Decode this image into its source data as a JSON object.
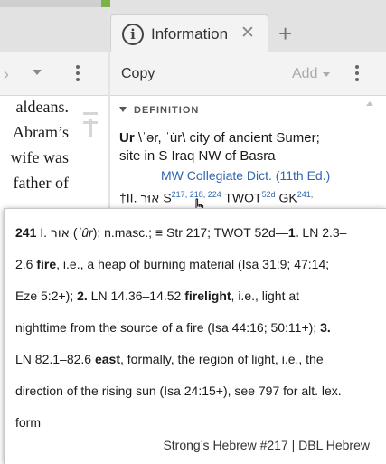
{
  "left_pane": {
    "reading_lines": [
      "aldeans.",
      "Abram’s",
      "wife was",
      "father of"
    ]
  },
  "right_pane": {
    "tab": {
      "icon": "info-circle-icon",
      "label": "Information"
    },
    "toolbar": {
      "copy_label": "Copy",
      "add_label": "Add"
    },
    "section_title": "DEFINITION",
    "definition": {
      "headword": "Ur",
      "pronunciation": "\\ˈər, ˈu̇r\\",
      "line1_text": " city of ancient Sumer;",
      "line2": "site in S Iraq NW of Basra",
      "source": "MW Collegiate Dict. (11th Ed.)"
    },
    "lexical_line": {
      "prefix": "†II. ",
      "hebrew": "אוּר",
      "strongs_prefix": " S",
      "strongs_refs": "217, 218, 224",
      "twot_prefix": " TWOT",
      "twot_ref": "52d",
      "gk_prefix": " GK",
      "gk_ref": "241,"
    }
  },
  "popup": {
    "line1": {
      "number": "241",
      "numeral": " I. ",
      "hebrew": "אוּר",
      "rest_a": " (",
      "translit": "ʾûr",
      "rest_b": "): n.masc.; ≡ Str 217; TWOT 52d—",
      "sense1": "1.",
      "rest_c": " LN 2.3–"
    },
    "line2": {
      "a": "2.6 ",
      "gloss": "fire",
      "b": ", i.e., a heap of burning material (Isa 31:9; 47:14;"
    },
    "line3": {
      "a": "Eze 5:2+); ",
      "sense2": "2.",
      "b": " LN 14.36–14.52 ",
      "gloss": "firelight",
      "c": ", i.e., light at"
    },
    "line4": {
      "a": "nighttime from the source of a fire (Isa 44:16; 50:11+); ",
      "sense3": "3."
    },
    "line5": {
      "a": "LN 82.1–82.6 ",
      "gloss": "east",
      "b": ", formally, the region of light, i.e., the"
    },
    "line6": "direction of the rising sun (Isa 24:15+), see 797 for alt. lex.",
    "line7": "form",
    "footer": "Strong’s Hebrew #217 | DBL Hebrew"
  },
  "colors": {
    "link": "#2f66b0",
    "accent_green": "#7cb342"
  }
}
